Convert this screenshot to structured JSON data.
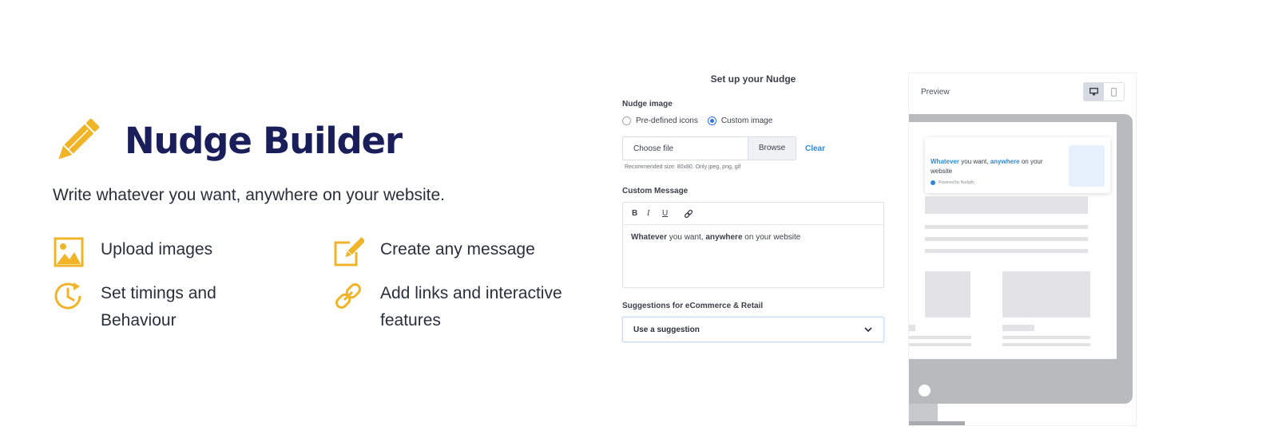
{
  "hero": {
    "title": "Nudge Builder",
    "subtitle": "Write whatever you want, anywhere on your website."
  },
  "features": [
    {
      "label": "Upload images",
      "icon": "image-icon"
    },
    {
      "label": "Create any message",
      "icon": "edit-message-icon"
    },
    {
      "label": "Set timings and Behaviour",
      "icon": "clock-icon"
    },
    {
      "label": "Add links and interactive features",
      "icon": "link-icon"
    }
  ],
  "form": {
    "title": "Set up your Nudge",
    "nudge_image_label": "Nudge image",
    "radio_predefined": "Pre-defined icons",
    "radio_custom": "Custom image",
    "selected_radio": "Custom image",
    "file_placeholder": "Choose file",
    "browse_label": "Browse",
    "clear_label": "Clear",
    "hint": "Recommended size: 80x80. Only jpeg, png, gif",
    "custom_message_label": "Custom Message",
    "toolbar": {
      "bold": "B",
      "italic": "I",
      "underline": "U"
    },
    "message": {
      "part1": "Whatever",
      "part2": " you want, ",
      "part3": "anywhere",
      "part4": " on your website"
    },
    "suggestions_label": "Suggestions for eCommerce & Retail",
    "select_value": "Use a suggestion"
  },
  "preview": {
    "label": "Preview",
    "active_device": "desktop",
    "nudge": {
      "hl1": "Whatever",
      "t1": " you want, ",
      "hl2": "anywhere",
      "t2": " on your website",
      "powered": "Powered by Nudgify"
    }
  },
  "colors": {
    "accent_orange": "#f0b429",
    "title_navy": "#1a1f5c",
    "link_blue": "#2f88d6"
  }
}
